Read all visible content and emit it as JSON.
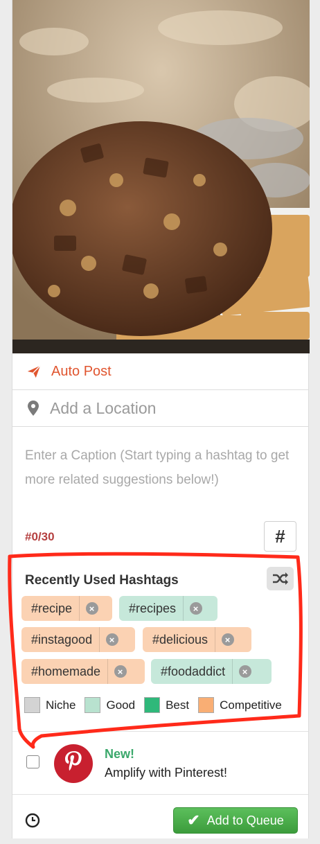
{
  "post": {
    "auto_post_label": "Auto Post",
    "location_placeholder": "Add a Location",
    "caption_placeholder": "Enter a Caption (Start typing a hashtag to get more related suggestions below!)",
    "hashtag_count": "#0/30",
    "hashtag_button": "#"
  },
  "recent": {
    "title": "Recently Used Hashtags",
    "tags": [
      {
        "label": "#recipe",
        "category": "Competitive"
      },
      {
        "label": "#recipes",
        "category": "Good"
      },
      {
        "label": "#instagood",
        "category": "Competitive"
      },
      {
        "label": "#delicious",
        "category": "Competitive"
      },
      {
        "label": "#homemade",
        "category": "Competitive"
      },
      {
        "label": "#foodaddict",
        "category": "Good"
      }
    ],
    "remove_glyph": "×"
  },
  "legend": [
    {
      "label": "Niche",
      "color": "#d3d3d3"
    },
    {
      "label": "Good",
      "color": "#b8e2cf"
    },
    {
      "label": "Best",
      "color": "#2fb87a"
    },
    {
      "label": "Competitive",
      "color": "#f9ae74"
    }
  ],
  "pinterest": {
    "badge": "New!",
    "text": "Amplify with Pinterest!"
  },
  "footer": {
    "queue_button": "Add to Queue",
    "check_glyph": "✔"
  },
  "colors": {
    "accent_orange": "#e0552f",
    "count_red": "#b54040",
    "annotation_red": "#ff2a1a",
    "pinterest_red": "#c8202f",
    "queue_green": "#47a847"
  }
}
